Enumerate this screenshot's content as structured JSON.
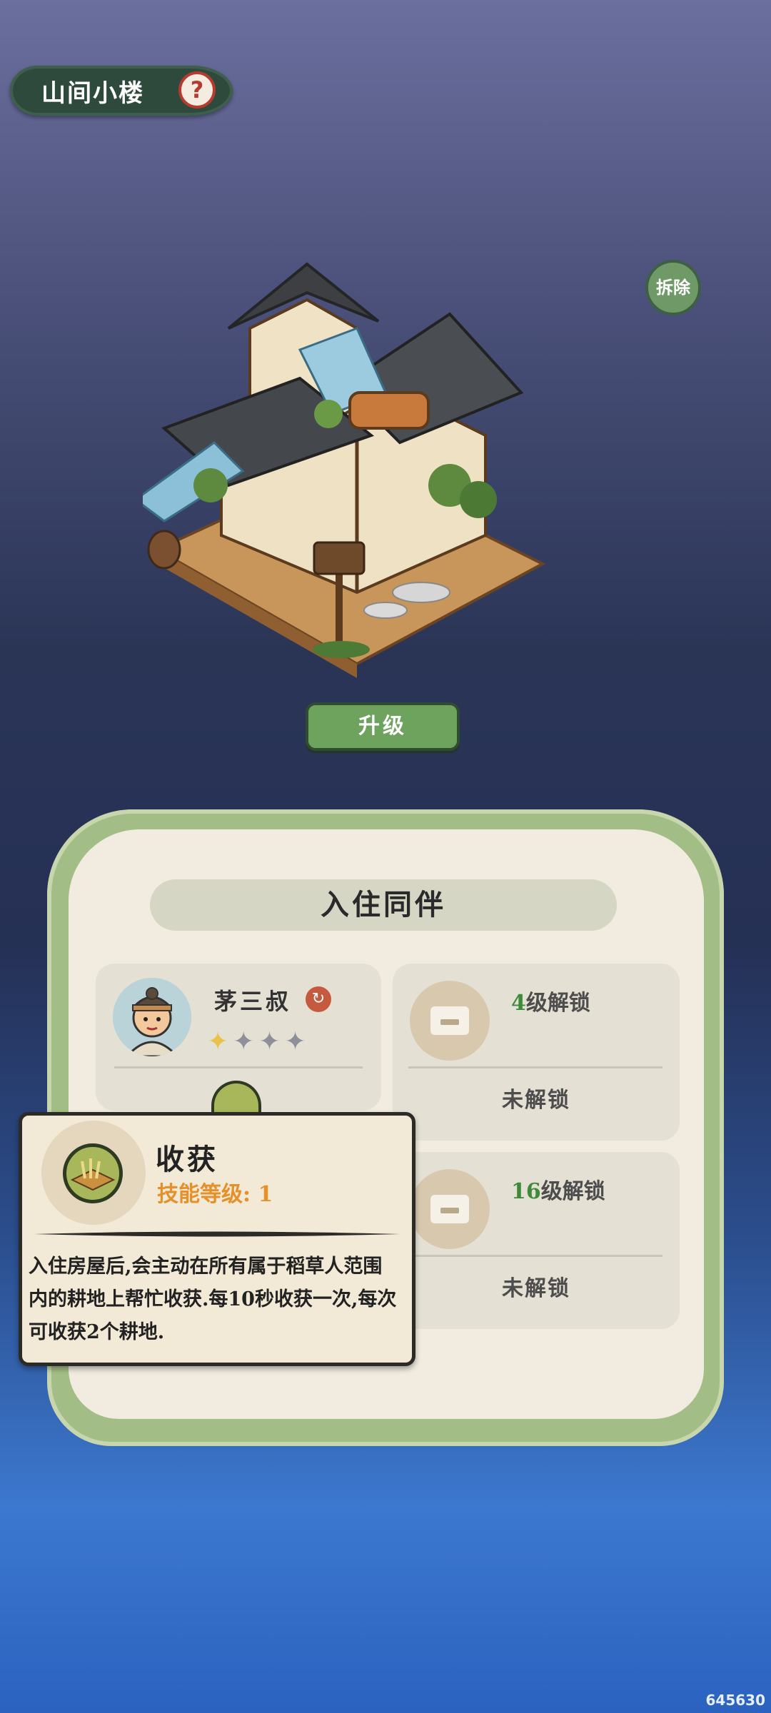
{
  "building": {
    "title": "山间小楼",
    "help_icon_glyph": "?",
    "demolish_label": "拆除",
    "upgrade_label": "升级"
  },
  "companions": {
    "title": "入住同伴",
    "occupant": {
      "name": "茅三叔",
      "swap_icon_glyph": "↻",
      "stars_filled": 1,
      "stars_total": 4
    },
    "slots": [
      {
        "unlock_level": "4",
        "unlock_suffix": "级解锁",
        "status": "未解锁"
      },
      {
        "unlock_level": "16",
        "unlock_suffix": "级解锁",
        "status": "未解锁"
      }
    ]
  },
  "skill_tooltip": {
    "name": "收获",
    "level_label": "技能等级: 1",
    "description": "入住房屋后,会主动在所有属于稻草人范围内的耕地上帮忙收获.每10秒收获一次,每次可收获2个耕地."
  },
  "watermark": "645630",
  "colors": {
    "green_button": "#6ea35e",
    "panel_border": "#a3bd86",
    "level_text": "#e5902b",
    "unlock_number": "#3f8a3a"
  }
}
